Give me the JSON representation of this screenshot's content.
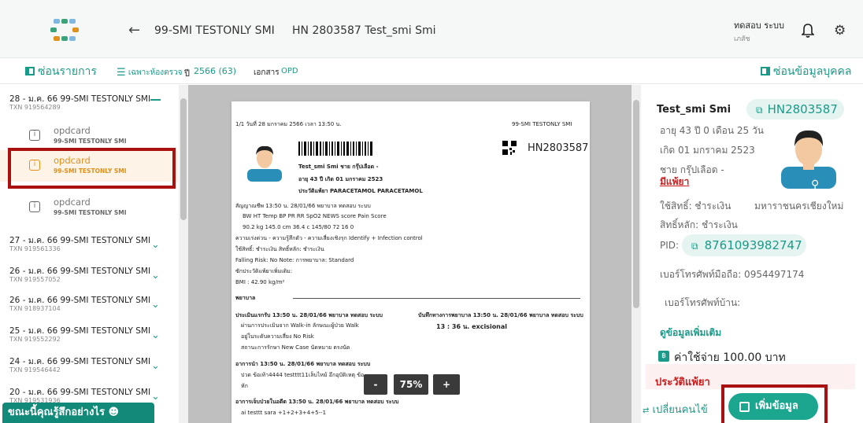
{
  "header": {
    "patient_title": "99-SMI TESTONLY SMI     HN 2803587 Test_smi Smi",
    "user_name": "ทดสอบ ระบบ",
    "user_role": "เภสัช"
  },
  "toolbar": {
    "hide_list": "ซ่อนรายการ",
    "filter_label": "เฉพาะห้องตรวจ",
    "year_label": "ปี",
    "year_value": "2566 (63)",
    "doc_label": "เอกสาร",
    "doc_value": "OPD",
    "hide_personal": "ซ่อนข้อมูลบุคคล"
  },
  "visits": [
    {
      "title": "28 - ม.ค. 66 99-SMI TESTONLY SMI",
      "txn": "TXN 919564289"
    },
    {
      "title": "27 - ม.ค. 66 99-SMI TESTONLY SMI",
      "txn": "TXN 919561336"
    },
    {
      "title": "26 - ม.ค. 66 99-SMI TESTONLY SMI",
      "txn": "TXN 919557052"
    },
    {
      "title": "26 - ม.ค. 66 99-SMI TESTONLY SMI",
      "txn": "TXN 918937104"
    },
    {
      "title": "25 - ม.ค. 66 99-SMI TESTONLY SMI",
      "txn": "TXN 919552292"
    },
    {
      "title": "24 - ม.ค. 66 99-SMI TESTONLY SMI",
      "txn": "TXN 919546442"
    },
    {
      "title": "20 - ม.ค. 66 99-SMI TESTONLY SMI",
      "txn": "TXN 919531936"
    }
  ],
  "subitems": [
    {
      "name": "opdcard",
      "clinic": "99-SMI TESTONLY SMI"
    },
    {
      "name": "opdcard",
      "clinic": "99-SMI TESTONLY SMI"
    },
    {
      "name": "opdcard",
      "clinic": "99-SMI TESTONLY SMI"
    }
  ],
  "doc": {
    "line1_left": "1/1   วันที่ 28 มกราคม 2566   เวลา 13:50 น.",
    "line1_right": "99-SMI TESTONLY SMI",
    "hn": "HN2803587",
    "name_line": "Test_smi Smi   ชาย   กรุ๊ปเลือด -",
    "age_line": "อายุ 43 ปี   เกิด 01 มกราคม 2523",
    "allergy_line": "ประวัติแพ้ยา PARACETAMOL PARACETAMOL",
    "vitals_head": "สัญญาณชีพ   13:50 น. 28/01/66 พยาบาล ทดสอบ ระบบ",
    "vitals_cols": "BW            HT           Temp        BP            PR          RR            SpO2         NEWS score Pain Score",
    "vitals_vals": "90.2 kg       145.0 cm   36.4 c       145/80      72          16                                                  0",
    "urgency": "ความเร่งด่วน -   ความรู้สึกตัว -   ความเสี่ยงเชิงรุก Identify + Infection control",
    "rights": "ใช้สิทธิ์: ชำระเงิน   สิทธิ์หลัก: ชำระเงิน",
    "fall": "Falling Risk:      No          Note:                                  การพยาบาล: Standard",
    "more_allergy": "ซักประวัติแพ้ยาเพิ่มเติม:",
    "bmi": "BMI : 42.90 kg/m²",
    "nurse": "พยาบาล",
    "assess": "ประเมินแรกรับ  13:50 น. 28/01/66 พยาบาล ทดสอบ ระบบ",
    "assess1": "ผ่านการประเมินจาก Walk-in  ลักษณะผู้ป่วย Walk",
    "assess2": "อยู่ในระดับความเสี่ยง No Risk",
    "assess3": "สถานะการรักษา New Case  นัดหมาย ตรงนัด",
    "note_head": "บันทึกทางการพยาบาล  13:50 น. 28/01/66 พยาบาล ทดสอบ ระบบ",
    "note_val": "13 : 36 น.   excisional",
    "cc_head": "อาการนำ  13:50 น. 28/01/66 พยาบาล ทดสอบ ระบบ",
    "cc1": "ปวด ข้อเท้า4444 testttt11เล็บไหม้ อึกอุบัติเหตุ ข้อ",
    "cc2": "หัก",
    "pi_head": "อาการเจ็บป่วยในอดีต  13:50 น. 28/01/66 พยาบาล ทดสอบ ระบบ",
    "pi1": "ai testtt sara +1+2+3+4+5--1"
  },
  "zoom": {
    "minus": "-",
    "value": "75%",
    "plus": "+"
  },
  "patient": {
    "name": "Test_smi Smi",
    "hn": "HN2803587",
    "age": "อายุ 43 ปี 0 เดือน 25 วัน",
    "born": "เกิด 01 มกราคม 2523",
    "sex_blood": "ชาย กรุ๊ปเลือด -",
    "allergy_link": "มีแพ้ยา",
    "right": "ใช้สิทธิ์: ชำระเงิน",
    "hospital": "มหาราชนครเชียงใหม่",
    "main_right": "สิทธิ์หลัก: ชำระเงิน",
    "pid_label": "PID:",
    "pid": "8761093982747",
    "mobile": "เบอร์โทรศัพท์มือถือ: 0954497174",
    "home_phone": "เบอร์โทรศัพท์บ้าน:",
    "more": "ดูข้อมูลเพิ่มเติม",
    "cost_badge": "฿",
    "cost": "ค่าใช้จ่าย 100.00 บาท",
    "allergy_title": "ประวัติแพ้ยา",
    "change_patient": "เปลี่ยนคนไข้",
    "add_data": "เพิ่มข้อมูล"
  },
  "chat": {
    "label": "ขณะนี้คุณรู้สึกอย่างไร"
  },
  "colors": {
    "teal": "#1a9a88",
    "orange": "#e0901c",
    "red": "#cc1f1f",
    "highlight_border": "#a91111"
  }
}
